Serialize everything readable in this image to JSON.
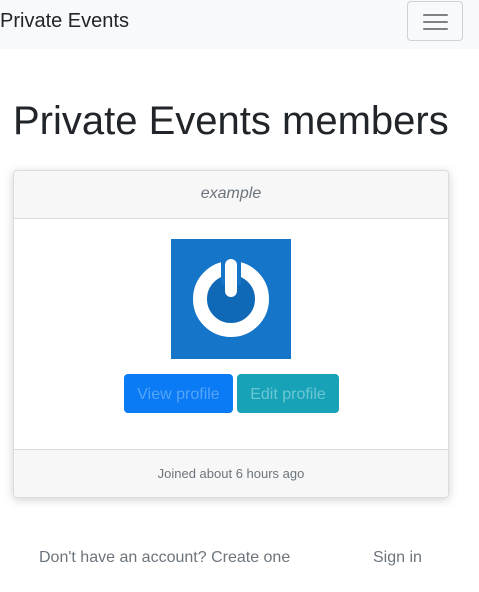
{
  "navbar": {
    "brand": "Private Events",
    "toggler_icon": "hamburger-menu-icon"
  },
  "page": {
    "title": "Private Events members"
  },
  "member_card": {
    "username": "example",
    "avatar_icon": "power-button-avatar-icon",
    "avatar_color": "#1575c9",
    "view_profile_label": "View profile",
    "edit_profile_label": "Edit profile",
    "joined_text": "Joined about 6 hours ago"
  },
  "footer_links": {
    "create_account": "Don't have an account? Create one",
    "sign_in": "Sign in"
  },
  "colors": {
    "navbar_bg": "#f8f9fa",
    "primary": "#0a7bf5",
    "info": "#17a2b8",
    "muted": "#6c757d"
  }
}
